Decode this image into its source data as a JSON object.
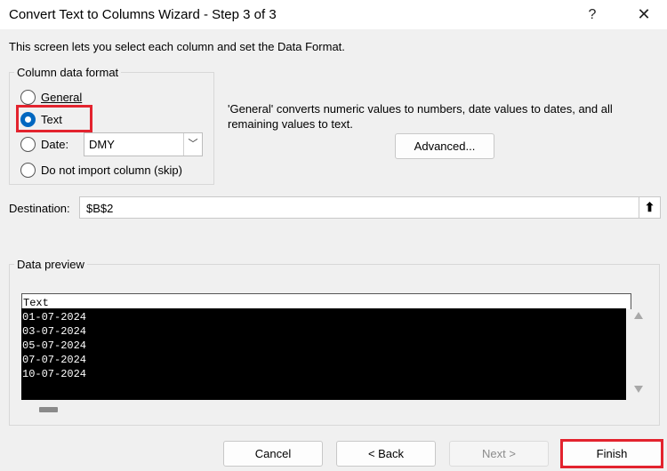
{
  "window": {
    "title": "Convert Text to Columns Wizard - Step 3 of 3",
    "help_label": "?",
    "close_label": "✕"
  },
  "description": "This screen lets you select each column and set the Data Format.",
  "column_format": {
    "legend": "Column data format",
    "options": [
      {
        "label": "General",
        "checked": false
      },
      {
        "label": "Text",
        "checked": true
      },
      {
        "label": "Date:",
        "checked": false
      },
      {
        "label": "Do not import column (skip)",
        "checked": false
      }
    ],
    "date_format": "DMY",
    "highlight_color": "#e3232e",
    "accent_color": "#0067c0"
  },
  "info_text": "'General' converts numeric values to numbers, date values to dates, and all remaining values to text.",
  "advanced_label": "Advanced...",
  "destination": {
    "label": "Destination:",
    "value": "$B$2",
    "button_icon": "collapse-upload-icon"
  },
  "preview": {
    "legend": "Data preview",
    "header": "Text",
    "rows": [
      "01-07-2024",
      "03-07-2024",
      "05-07-2024",
      "07-07-2024",
      "10-07-2024"
    ]
  },
  "buttons": {
    "cancel": "Cancel",
    "back": "< Back",
    "next": "Next >",
    "finish": "Finish"
  }
}
